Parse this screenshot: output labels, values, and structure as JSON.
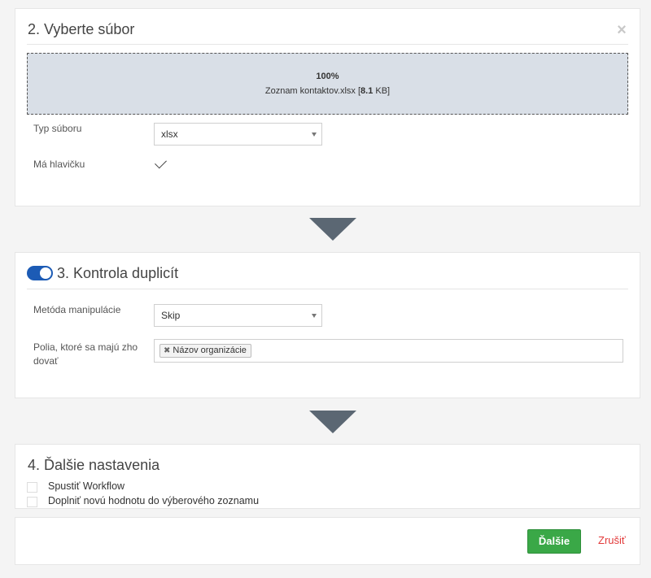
{
  "section_file": {
    "title": "2. Vyberte súbor",
    "upload": {
      "percent": "100%",
      "file_name": "Zoznam kontaktov.xlsx [",
      "file_size": "8.1",
      "file_size_unit": " KB]"
    },
    "file_type_label": "Typ súboru",
    "file_type_value": "xlsx",
    "has_header_label": "Má hlavičku",
    "has_header_checked": true
  },
  "section_duplicates": {
    "title": "3. Kontrola duplicít",
    "enabled": true,
    "method_label": "Metóda manipulácie",
    "method_value": "Skip",
    "fields_label_line1": "Polia, ktoré sa majú zho",
    "fields_label_line2": "dovať",
    "fields_tags": [
      "Názov organizácie"
    ]
  },
  "section_other": {
    "title": "4. Ďalšie nastavenia",
    "options": [
      {
        "label": "Spustiť Workflow",
        "checked": false
      },
      {
        "label": "Doplniť novú hodnotu do výberového zoznamu",
        "checked": false
      }
    ]
  },
  "footer": {
    "next_label": "Ďalšie",
    "cancel_label": "Zrušiť"
  },
  "colors": {
    "accent_blue": "#1c5bb5",
    "success_green": "#3aa847",
    "danger_red": "#e23a3a",
    "arrow_gray": "#5b6773"
  }
}
